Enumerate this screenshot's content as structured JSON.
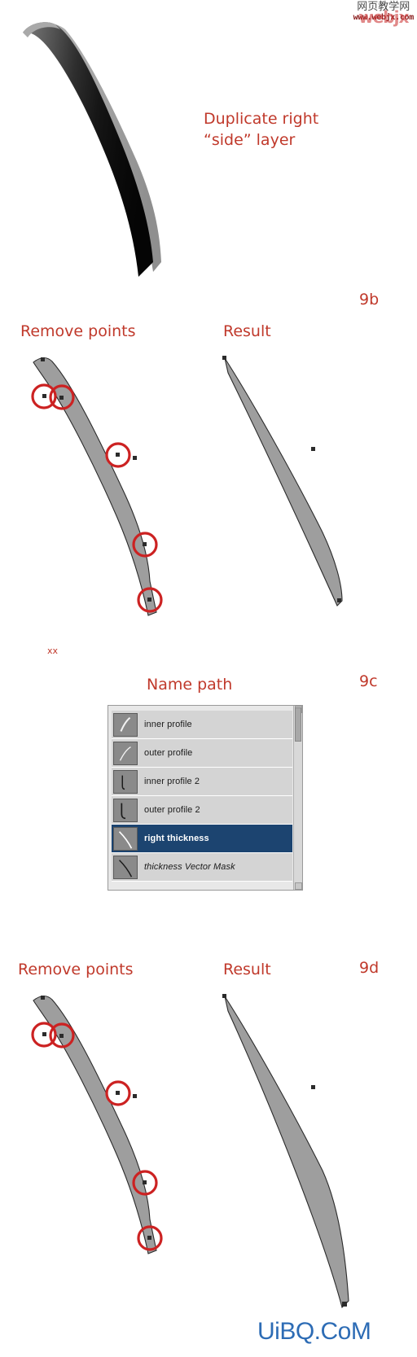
{
  "watermark": {
    "cn_text": "网页教学网",
    "url_text": "www.webjx.com",
    "stamp_text": "webjx"
  },
  "annotations": {
    "duplicate_layer": "Duplicate right\n“side” layer",
    "remove_points_1": "Remove points",
    "result_1": "Result",
    "name_path": "Name path",
    "remove_points_2": "Remove points",
    "result_2": "Result",
    "xx_marker": "xx"
  },
  "step_labels": {
    "step_9b": "9b",
    "step_9c": "9c",
    "step_9d": "9d"
  },
  "paths_panel": {
    "rows": [
      {
        "name": "inner profile",
        "selected": false,
        "italic": false,
        "icon": "path-stroke-icon"
      },
      {
        "name": "outer profile",
        "selected": false,
        "italic": false,
        "icon": "path-stroke-icon"
      },
      {
        "name": "inner profile 2",
        "selected": false,
        "italic": false,
        "icon": "path-stroke-icon"
      },
      {
        "name": "outer profile 2",
        "selected": false,
        "italic": false,
        "icon": "path-stroke-icon"
      },
      {
        "name": "right thickness",
        "selected": true,
        "italic": false,
        "icon": "path-stroke-icon"
      },
      {
        "name": "thickness Vector Mask",
        "selected": false,
        "italic": true,
        "icon": "vector-mask-icon"
      }
    ]
  },
  "site_watermark": {
    "text": "UiBQ.CoM"
  },
  "colors": {
    "annotation_red": "#c0392b",
    "shape_gray": "#9e9e9e",
    "selected_row_blue": "#1c4470",
    "uibq_blue": "#2d6cb5"
  }
}
